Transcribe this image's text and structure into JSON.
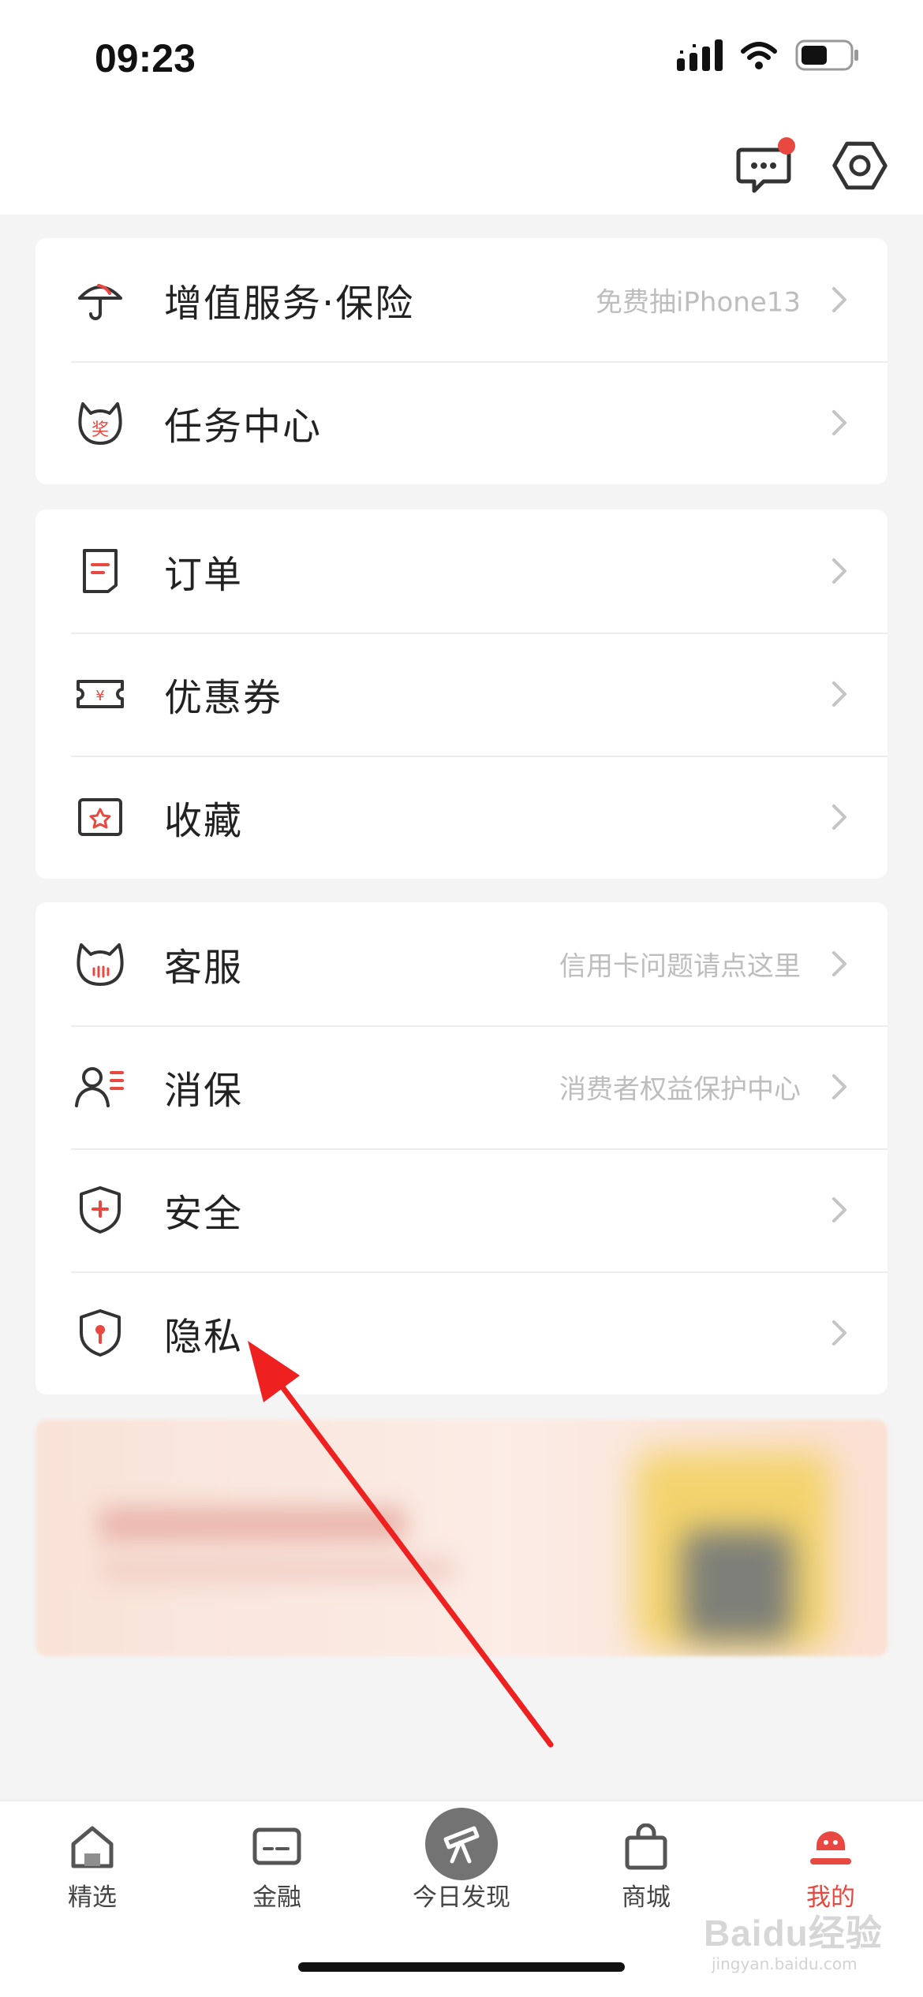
{
  "status_bar": {
    "time": "09:23"
  },
  "header": {
    "message_icon": "chat-bubble-icon",
    "settings_icon": "hexagon-gear-icon",
    "has_unread": true
  },
  "groups": [
    [
      {
        "label": "增值服务·保险",
        "hint": "免费抽iPhone13",
        "icon": "umbrella-icon"
      },
      {
        "label": "任务中心",
        "hint": "",
        "icon": "reward-cat-icon"
      }
    ],
    [
      {
        "label": "订单",
        "hint": "",
        "icon": "order-icon"
      },
      {
        "label": "优惠券",
        "hint": "",
        "icon": "coupon-icon"
      },
      {
        "label": "收藏",
        "hint": "",
        "icon": "favorite-star-icon"
      }
    ],
    [
      {
        "label": "客服",
        "hint": "信用卡问题请点这里",
        "icon": "customer-service-icon"
      },
      {
        "label": "消保",
        "hint": "消费者权益保护中心",
        "icon": "consumer-protection-icon"
      },
      {
        "label": "安全",
        "hint": "",
        "icon": "security-shield-icon"
      },
      {
        "label": "隐私",
        "hint": "",
        "icon": "privacy-shield-icon"
      }
    ]
  ],
  "tabs": [
    {
      "label": "精选",
      "icon": "home-icon",
      "active": false
    },
    {
      "label": "金融",
      "icon": "card-icon",
      "active": false
    },
    {
      "label": "今日发现",
      "icon": "telescope-icon",
      "active": false
    },
    {
      "label": "商城",
      "icon": "shopping-bag-icon",
      "active": false
    },
    {
      "label": "我的",
      "icon": "profile-icon",
      "active": true
    }
  ],
  "watermark": {
    "text": "Baidu经验",
    "sub": "jingyan.baidu.com"
  },
  "colors": {
    "accent": "#e8483f",
    "icon_dark": "#333333",
    "chevron": "#c4c4c4",
    "hint": "#bdbdbd"
  }
}
